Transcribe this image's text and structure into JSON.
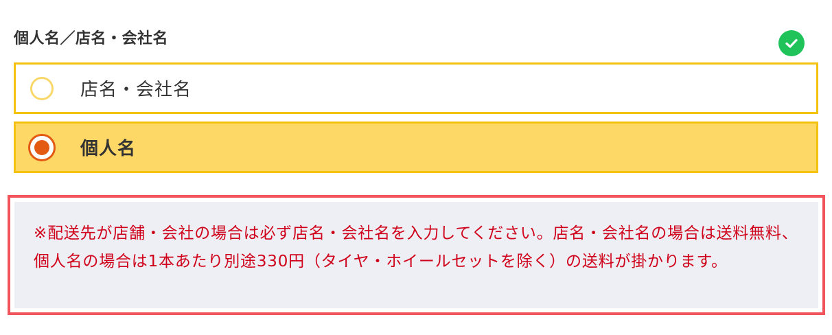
{
  "form": {
    "field_label": "個人名／店名・会社名",
    "valid_icon": "check-circle-icon",
    "options": [
      {
        "label": "店名・会社名",
        "selected": false
      },
      {
        "label": "個人名",
        "selected": true
      }
    ]
  },
  "notice": {
    "text": "※配送先が店舗・会社の場合は必ず店名・会社名を入力してください。店名・会社名の場合は送料無料、個人名の場合は1本あたり別途330円（タイヤ・ホイールセットを除く）の送料が掛かります。"
  },
  "colors": {
    "border_yellow": "#f5c211",
    "selected_bg": "#fed866",
    "radio_selected": "#e35a12",
    "valid_green": "#1fc35a",
    "notice_border": "#f2545b",
    "notice_bg": "#edeff4",
    "notice_text": "#d0021b"
  }
}
